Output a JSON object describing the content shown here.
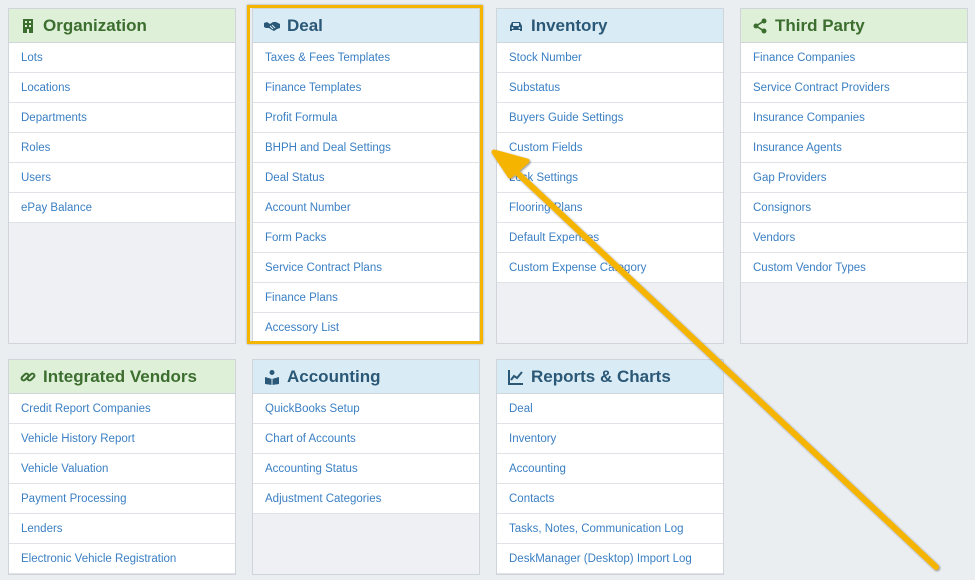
{
  "panels": {
    "organization": {
      "title": "Organization",
      "items": [
        "Lots",
        "Locations",
        "Departments",
        "Roles",
        "Users",
        "ePay Balance"
      ]
    },
    "deal": {
      "title": "Deal",
      "items": [
        "Taxes & Fees Templates",
        "Finance Templates",
        "Profit Formula",
        "BHPH and Deal Settings",
        "Deal Status",
        "Account Number",
        "Form Packs",
        "Service Contract Plans",
        "Finance Plans",
        "Accessory List"
      ]
    },
    "inventory": {
      "title": "Inventory",
      "items": [
        "Stock Number",
        "Substatus",
        "Buyers Guide Settings",
        "Custom Fields",
        "Lock Settings",
        "Flooring Plans",
        "Default Expenses",
        "Custom Expense Category"
      ]
    },
    "third_party": {
      "title": "Third Party",
      "items": [
        "Finance Companies",
        "Service Contract Providers",
        "Insurance Companies",
        "Insurance Agents",
        "Gap Providers",
        "Consignors",
        "Vendors",
        "Custom Vendor Types"
      ]
    },
    "integrated_vendors": {
      "title": "Integrated Vendors",
      "items": [
        "Credit Report Companies",
        "Vehicle History Report",
        "Vehicle Valuation",
        "Payment Processing",
        "Lenders",
        "Electronic Vehicle Registration"
      ]
    },
    "accounting": {
      "title": "Accounting",
      "items": [
        "QuickBooks Setup",
        "Chart of Accounts",
        "Accounting Status",
        "Adjustment Categories"
      ]
    },
    "reports": {
      "title": "Reports & Charts",
      "items": [
        "Deal",
        "Inventory",
        "Accounting",
        "Contacts",
        "Tasks, Notes, Communication Log",
        "DeskManager (Desktop) Import Log"
      ]
    }
  },
  "icons": {
    "organization": "building-icon",
    "deal": "handshake-icon",
    "inventory": "car-icon",
    "third_party": "share-icon",
    "integrated_vendors": "link-icon",
    "accounting": "users-book-icon",
    "reports": "line-chart-icon"
  },
  "colors": {
    "green_header_bg": "#dff0d8",
    "green_header_text": "#3c6e2f",
    "blue_header_bg": "#d9ecf6",
    "blue_header_text": "#2b5876",
    "link": "#3a7fc3",
    "highlight": "#f5b400"
  }
}
